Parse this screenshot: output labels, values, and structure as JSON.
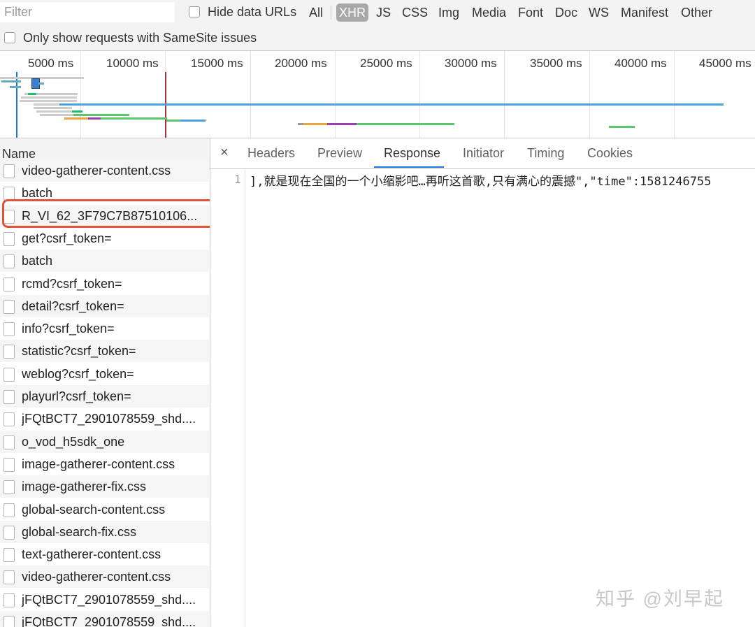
{
  "toolbar": {
    "filter_placeholder": "Filter",
    "hide_data_urls": "Hide data URLs",
    "types": [
      "All",
      "XHR",
      "JS",
      "CSS",
      "Img",
      "Media",
      "Font",
      "Doc",
      "WS",
      "Manifest",
      "Other"
    ],
    "active_type": "XHR",
    "samesite": "Only show requests with SameSite issues"
  },
  "overview": {
    "ticks": [
      "5000 ms",
      "10000 ms",
      "15000 ms",
      "20000 ms",
      "25000 ms",
      "30000 ms",
      "35000 ms",
      "40000 ms",
      "45000 ms"
    ]
  },
  "requests": {
    "header": "Name",
    "items": [
      "video-gatherer-content.css",
      "batch",
      "R_VI_62_3F79C7B87510106...",
      "get?csrf_token=",
      "batch",
      "rcmd?csrf_token=",
      "detail?csrf_token=",
      "info?csrf_token=",
      "statistic?csrf_token=",
      "weblog?csrf_token=",
      "playurl?csrf_token=",
      "jFQtBCT7_2901078559_shd....",
      "o_vod_h5sdk_one",
      "image-gatherer-content.css",
      "image-gatherer-fix.css",
      "global-search-content.css",
      "global-search-fix.css",
      "text-gatherer-content.css",
      "video-gatherer-content.css",
      "jFQtBCT7_2901078559_shd....",
      "jFQtBCT7_2901078559_shd...."
    ]
  },
  "detail": {
    "close": "×",
    "tabs": [
      "Headers",
      "Preview",
      "Response",
      "Initiator",
      "Timing",
      "Cookies"
    ],
    "active_tab": "Response",
    "line_number": "1",
    "response_text": "],就是现在全国的一个小缩影吧…再听这首歌,只有满心的震撼\",\"time\":1581246755"
  },
  "watermark": "知乎 @刘早起",
  "colors": {
    "accent": "#1a73e8",
    "highlight": "#e0533a",
    "active_filter": "#a8a8a8"
  }
}
